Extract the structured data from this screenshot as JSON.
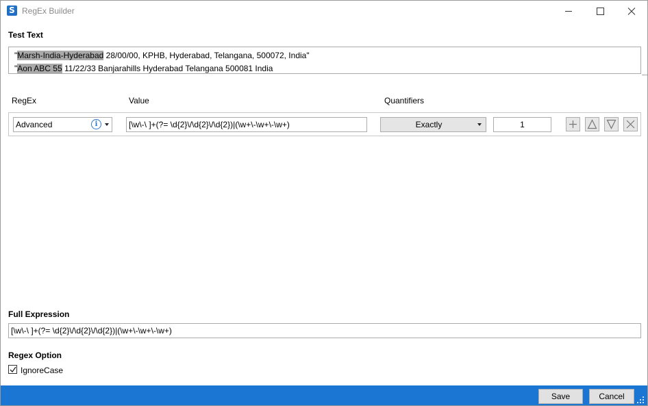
{
  "window": {
    "title": "RegEx Builder"
  },
  "test_text": {
    "label": "Test Text",
    "lines": [
      {
        "prefix": "\"",
        "match": "Marsh-India-Hyderabad",
        "rest": " 28/00/00, KPHB, Hyderabad, Telangana, 500072, India\""
      },
      {
        "prefix": "\"",
        "match": "Aon ABC 55",
        "rest": " 11/22/33 Banjarahills Hyderabad Telangana 500081 India"
      }
    ]
  },
  "columns": {
    "regex": "RegEx",
    "value": "Value",
    "quantifiers": "Quantifiers"
  },
  "regex_row": {
    "regex_type": "Advanced",
    "value": "[\\w\\-\\ ]+(?= \\d{2}\\/\\d{2}\\/\\d{2})|(\\w+\\-\\w+\\-\\w+)",
    "quantifier": "Exactly",
    "count": "1"
  },
  "full_expression": {
    "label": "Full Expression",
    "value": "[\\w\\-\\ ]+(?= \\d{2}\\/\\d{2}\\/\\d{2})|(\\w+\\-\\w+\\-\\w+)"
  },
  "regex_option": {
    "label": "Regex Option",
    "ignore_case_label": "IgnoreCase",
    "ignore_case_checked": true
  },
  "footer": {
    "save_label": "Save",
    "cancel_label": "Cancel"
  },
  "colors": {
    "footer_bg": "#1a76d2",
    "highlight": "#a9a9a9",
    "info_accent": "#2a78d0"
  },
  "icons": [
    "app-icon",
    "minimize-icon",
    "maximize-icon",
    "close-icon",
    "info-icon",
    "chevron-down-icon",
    "plus-icon",
    "move-up-icon",
    "move-down-icon",
    "delete-icon",
    "check-icon",
    "resize-grip-icon"
  ]
}
